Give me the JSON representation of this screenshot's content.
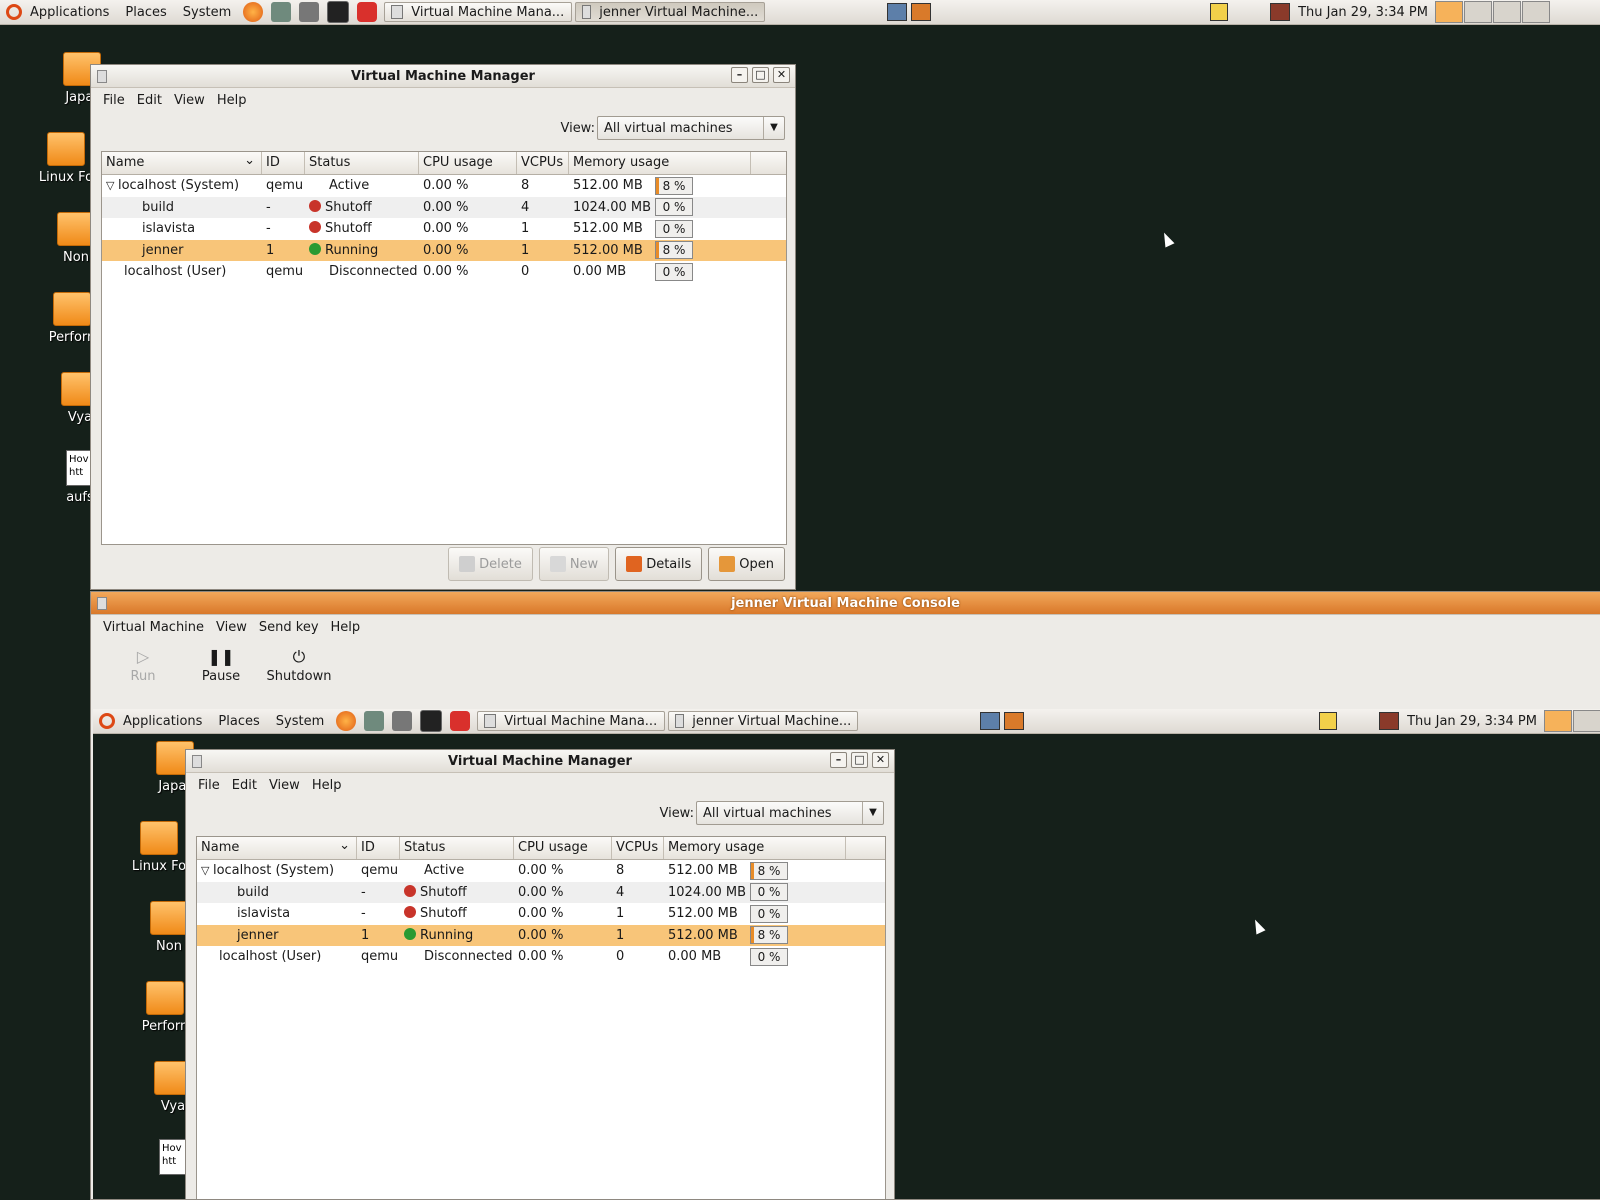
{
  "panel": {
    "menus": [
      "Applications",
      "Places",
      "System"
    ],
    "tasks": [
      "Virtual Machine Mana...",
      "jenner Virtual Machine..."
    ],
    "clock": "Thu Jan 29,  3:34 PM"
  },
  "desktop": {
    "icons": [
      "Japar",
      "Linux Fo",
      "Non",
      "Perforn",
      "Vya",
      "aufs"
    ],
    "doc_lines": [
      "Hov",
      "htt"
    ]
  },
  "manager": {
    "title": "Virtual Machine Manager",
    "menu": [
      "File",
      "Edit",
      "View",
      "Help"
    ],
    "view_label": "View:",
    "view_value": "All virtual machines",
    "columns": [
      "Name",
      "ID",
      "Status",
      "CPU usage",
      "VCPUs",
      "Memory usage"
    ],
    "rows": [
      {
        "name": "localhost (System)",
        "id": "qemu",
        "status": "Active",
        "cpu": "0.00 %",
        "vcpus": "8",
        "mem": "512.00 MB",
        "pct": "8 %",
        "pct_value": 8
      },
      {
        "name": "build",
        "id": "-",
        "status": "Shutoff",
        "cpu": "0.00 %",
        "vcpus": "4",
        "mem": "1024.00 MB",
        "pct": "0 %",
        "pct_value": 0
      },
      {
        "name": "islavista",
        "id": "-",
        "status": "Shutoff",
        "cpu": "0.00 %",
        "vcpus": "1",
        "mem": "512.00 MB",
        "pct": "0 %",
        "pct_value": 0
      },
      {
        "name": "jenner",
        "id": "1",
        "status": "Running",
        "cpu": "0.00 %",
        "vcpus": "1",
        "mem": "512.00 MB",
        "pct": "8 %",
        "pct_value": 8
      },
      {
        "name": "localhost (User)",
        "id": "qemu",
        "status": "Disconnected",
        "cpu": "0.00 %",
        "vcpus": "0",
        "mem": "0.00 MB",
        "pct": "0 %",
        "pct_value": 0
      }
    ],
    "buttons": {
      "delete": "Delete",
      "new": "New",
      "details": "Details",
      "open": "Open"
    }
  },
  "console": {
    "title": "jenner Virtual Machine Console",
    "menu": [
      "Virtual Machine",
      "View",
      "Send key",
      "Help"
    ],
    "tools": {
      "run": "Run",
      "pause": "Pause",
      "shutdown": "Shutdown"
    }
  },
  "colors": {
    "accent": "#e88c28",
    "selection": "#f8c579",
    "desktop": "#15201a"
  }
}
